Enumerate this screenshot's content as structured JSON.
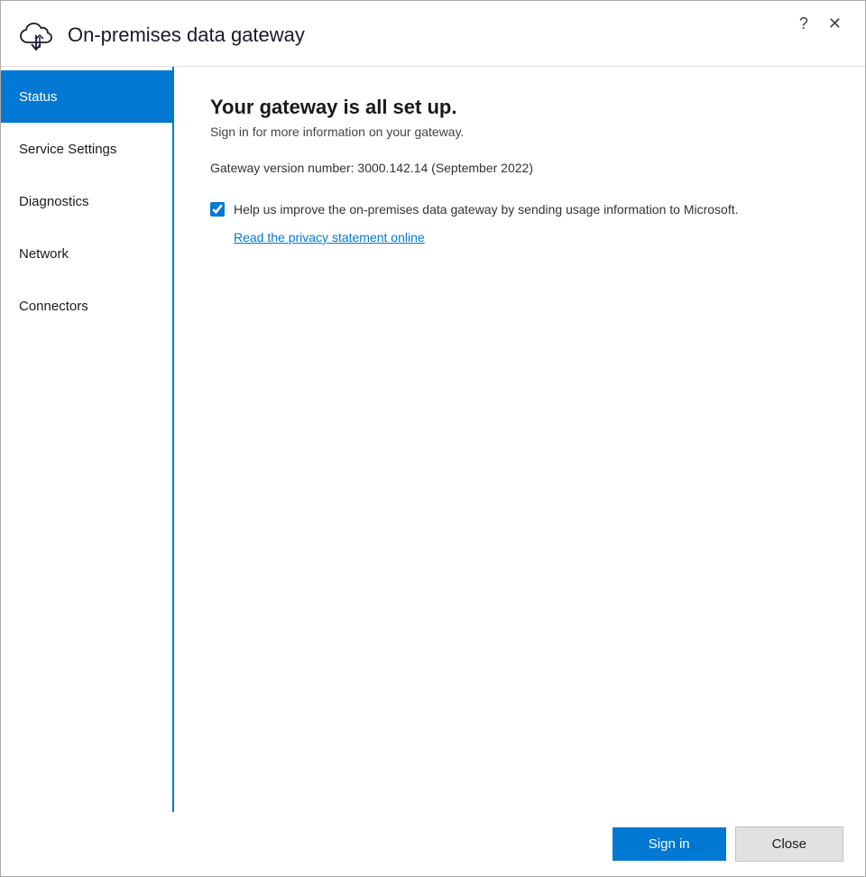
{
  "header": {
    "title": "On-premises data gateway",
    "help_icon": "?",
    "close_icon": "✕"
  },
  "sidebar": {
    "items": [
      {
        "id": "status",
        "label": "Status",
        "active": true
      },
      {
        "id": "service-settings",
        "label": "Service Settings",
        "active": false
      },
      {
        "id": "diagnostics",
        "label": "Diagnostics",
        "active": false
      },
      {
        "id": "network",
        "label": "Network",
        "active": false
      },
      {
        "id": "connectors",
        "label": "Connectors",
        "active": false
      }
    ]
  },
  "main": {
    "status_title": "Your gateway is all set up.",
    "status_subtitle": "Sign in for more information on your gateway.",
    "version_label": "Gateway version number: 3000.142.14 (September 2022)",
    "usage_checkbox_label": "Help us improve the on-premises data gateway by sending usage information to Microsoft.",
    "privacy_link_label": "Read the privacy statement online"
  },
  "footer": {
    "signin_label": "Sign in",
    "close_label": "Close"
  }
}
